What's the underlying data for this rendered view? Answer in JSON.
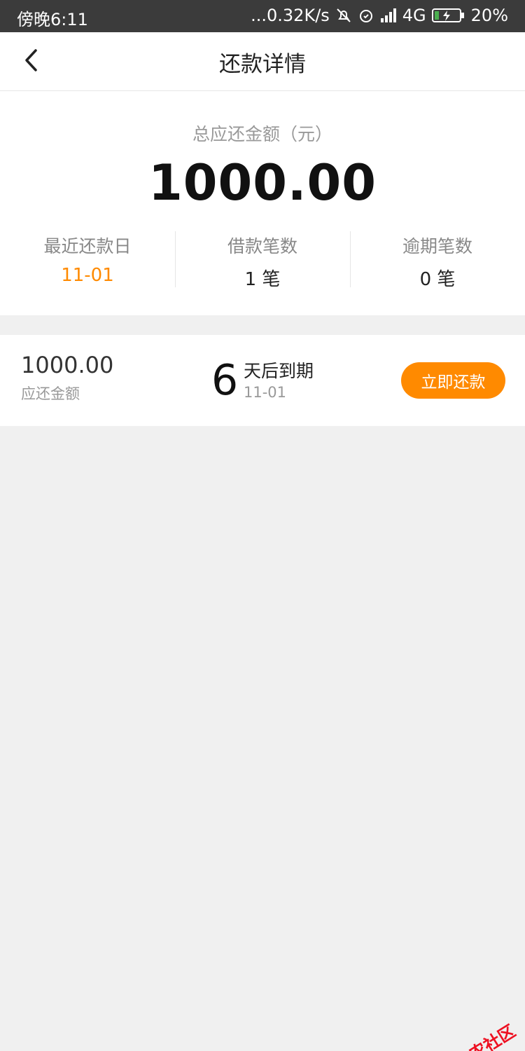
{
  "status_bar": {
    "time": "傍晚6:11",
    "network_speed": "...0.32K/s",
    "network_type": "4G",
    "battery": "20%",
    "icons": [
      "mute-icon",
      "alarm-icon",
      "signal-icon",
      "battery-charging-icon"
    ]
  },
  "header": {
    "title": "还款详情",
    "back_icon": "chevron-left-icon"
  },
  "summary": {
    "total_label": "总应还金额（元）",
    "total_amount": "1000.00",
    "stats": [
      {
        "label": "最近还款日",
        "value": "11-01"
      },
      {
        "label": "借款笔数",
        "value": "1 笔"
      },
      {
        "label": "逾期笔数",
        "value": "0 笔"
      }
    ]
  },
  "loan": {
    "amount": "1000.00",
    "amount_label": "应还金额",
    "days_remaining": "6",
    "due_text": "天后到期",
    "due_date": "11-01",
    "repay_button": "立即还款"
  },
  "colors": {
    "accent": "#ff8a00",
    "status_bar": "#3b3b3b",
    "background": "#f0f0f0"
  },
  "watermark": {
    "text": "卡农社区"
  }
}
